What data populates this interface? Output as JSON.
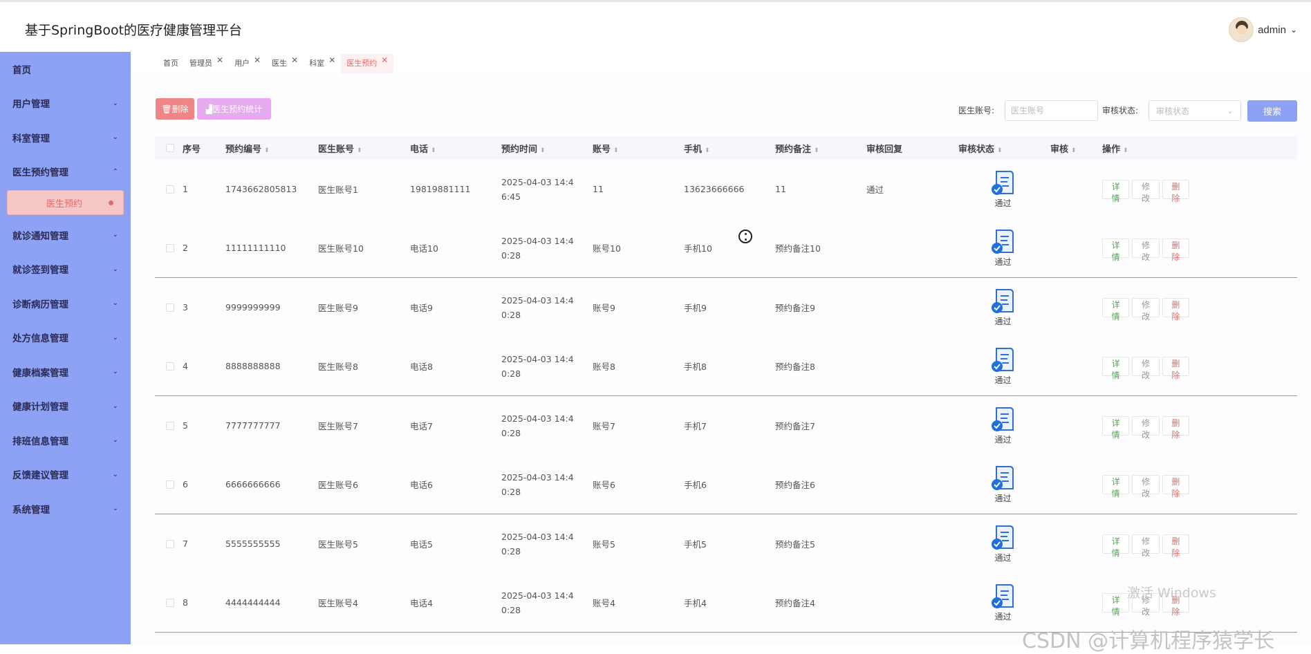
{
  "header": {
    "title": "基于SpringBoot的医疗健康管理平台",
    "username": "admin"
  },
  "sidebar": {
    "items": [
      {
        "label": "首页",
        "chevron": ""
      },
      {
        "label": "用户管理",
        "chevron": "⌄"
      },
      {
        "label": "科室管理",
        "chevron": "⌄"
      },
      {
        "label": "医生预约管理",
        "chevron": "⌃"
      },
      {
        "label": "就诊通知管理",
        "chevron": "⌄"
      },
      {
        "label": "就诊签到管理",
        "chevron": "⌄"
      },
      {
        "label": "诊断病历管理",
        "chevron": "⌄"
      },
      {
        "label": "处方信息管理",
        "chevron": "⌄"
      },
      {
        "label": "健康档案管理",
        "chevron": "⌄"
      },
      {
        "label": "健康计划管理",
        "chevron": "⌄"
      },
      {
        "label": "排班信息管理",
        "chevron": "⌄"
      },
      {
        "label": "反馈建议管理",
        "chevron": "⌄"
      },
      {
        "label": "系统管理",
        "chevron": "⌄"
      }
    ],
    "active_sub": "医生预约"
  },
  "tabs": [
    {
      "label": "首页",
      "closable": false
    },
    {
      "label": "管理员",
      "closable": true
    },
    {
      "label": "用户",
      "closable": true
    },
    {
      "label": "医生",
      "closable": true
    },
    {
      "label": "科室",
      "closable": true
    },
    {
      "label": "医生预约",
      "closable": true,
      "active": true
    }
  ],
  "toolbar": {
    "delete_label": "删除",
    "delete_icon": "trash-icon",
    "stats_label": "医生预约统计",
    "stats_icon": "bar-chart-icon"
  },
  "search": {
    "doctor_label": "医生账号:",
    "doctor_placeholder": "医生账号",
    "status_label": "审核状态:",
    "status_placeholder": "审核状态",
    "button": "搜索"
  },
  "table": {
    "columns": [
      "序号",
      "预约编号",
      "医生账号",
      "电话",
      "预约时间",
      "账号",
      "手机",
      "预约备注",
      "审核回复",
      "审核状态",
      "审核",
      "操作"
    ],
    "rows": [
      {
        "idx": "1",
        "no": "1743662805813",
        "doctor": "医生账号1",
        "phone": "19819881111",
        "time": "2025-04-03 14:46:45",
        "account": "11",
        "mobile": "13623666666",
        "note": "11",
        "reply": "通过",
        "status": "通过"
      },
      {
        "idx": "2",
        "no": "11111111110",
        "doctor": "医生账号10",
        "phone": "电话10",
        "time": "2025-04-03 14:40:28",
        "account": "账号10",
        "mobile": "手机10",
        "note": "预约备注10",
        "reply": "",
        "status": "通过"
      },
      {
        "idx": "3",
        "no": "9999999999",
        "doctor": "医生账号9",
        "phone": "电话9",
        "time": "2025-04-03 14:40:28",
        "account": "账号9",
        "mobile": "手机9",
        "note": "预约备注9",
        "reply": "",
        "status": "通过"
      },
      {
        "idx": "4",
        "no": "8888888888",
        "doctor": "医生账号8",
        "phone": "电话8",
        "time": "2025-04-03 14:40:28",
        "account": "账号8",
        "mobile": "手机8",
        "note": "预约备注8",
        "reply": "",
        "status": "通过"
      },
      {
        "idx": "5",
        "no": "7777777777",
        "doctor": "医生账号7",
        "phone": "电话7",
        "time": "2025-04-03 14:40:28",
        "account": "账号7",
        "mobile": "手机7",
        "note": "预约备注7",
        "reply": "",
        "status": "通过"
      },
      {
        "idx": "6",
        "no": "6666666666",
        "doctor": "医生账号6",
        "phone": "电话6",
        "time": "2025-04-03 14:40:28",
        "account": "账号6",
        "mobile": "手机6",
        "note": "预约备注6",
        "reply": "",
        "status": "通过"
      },
      {
        "idx": "7",
        "no": "5555555555",
        "doctor": "医生账号5",
        "phone": "电话5",
        "time": "2025-04-03 14:40:28",
        "account": "账号5",
        "mobile": "手机5",
        "note": "预约备注5",
        "reply": "",
        "status": "通过"
      },
      {
        "idx": "8",
        "no": "4444444444",
        "doctor": "医生账号4",
        "phone": "电话4",
        "time": "2025-04-03 14:40:28",
        "account": "账号4",
        "mobile": "手机4",
        "note": "预约备注4",
        "reply": "",
        "status": "通过"
      }
    ],
    "ops": {
      "detail": "详情",
      "edit": "修改",
      "delete": "删除"
    }
  },
  "overlay": {
    "activate_text": "激活 Windows",
    "watermark": "CSDN @计算机程序猿学长"
  },
  "colors": {
    "sidebar": "#8ea2f5",
    "accent": "#e46a6a",
    "delete_btn": "#f08585",
    "stats_btn": "#e7a9f0",
    "search_btn": "#8ea2f5"
  }
}
